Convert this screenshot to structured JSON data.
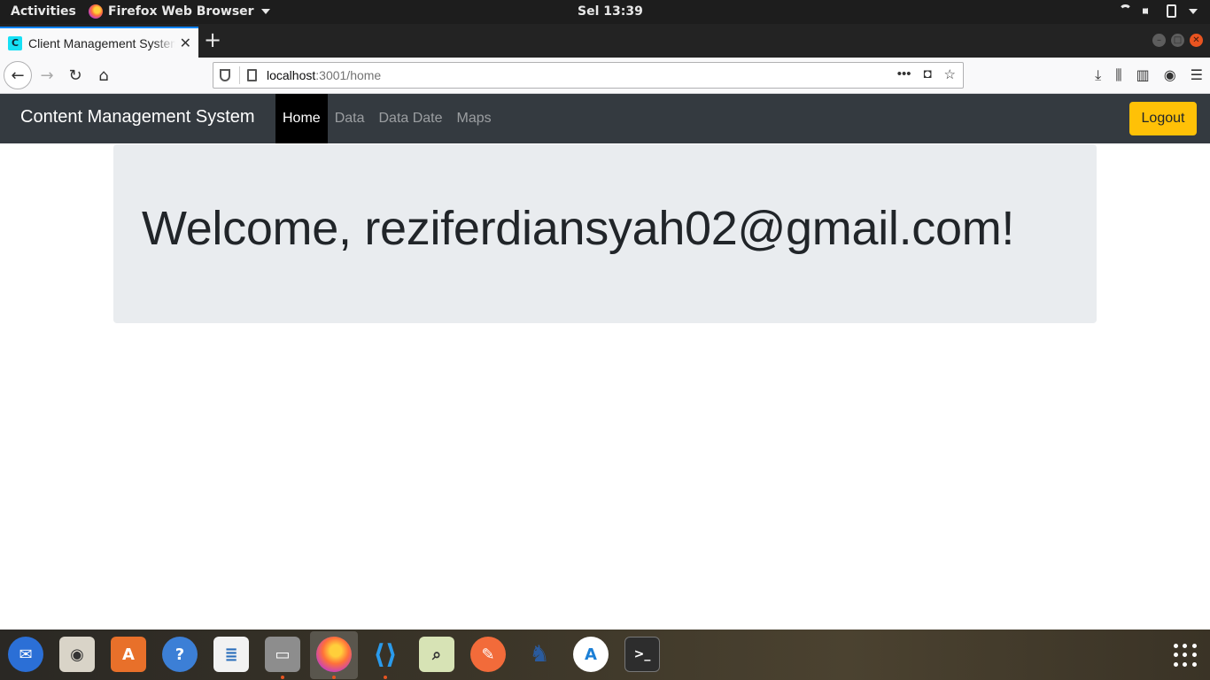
{
  "system_bar": {
    "activities": "Activities",
    "app_name": "Firefox Web Browser",
    "clock": "Sel 13:39"
  },
  "browser": {
    "tab_title": "Client Management System",
    "favicon_letter": "C",
    "url_host": "localhost",
    "url_rest": ":3001/home"
  },
  "page": {
    "brand": "Content Management System",
    "nav": [
      {
        "label": "Home",
        "active": true
      },
      {
        "label": "Data",
        "active": false
      },
      {
        "label": "Data Date",
        "active": false
      },
      {
        "label": "Maps",
        "active": false
      }
    ],
    "logout_label": "Logout",
    "welcome": "Welcome, reziferdiansyah02@gmail.com!"
  },
  "colors": {
    "navbar": "#343a40",
    "logout": "#ffc107",
    "jumbotron": "#e9ecef",
    "ubuntu_orange": "#e95420"
  },
  "dock": {
    "apps": [
      "thunderbird-icon",
      "rhythmbox-icon",
      "software-center-icon",
      "help-icon",
      "writer-icon",
      "files-icon",
      "firefox-icon",
      "vscode-icon",
      "image-viewer-icon",
      "postman-icon",
      "pgadmin-icon",
      "android-studio-icon",
      "terminal-icon"
    ]
  }
}
